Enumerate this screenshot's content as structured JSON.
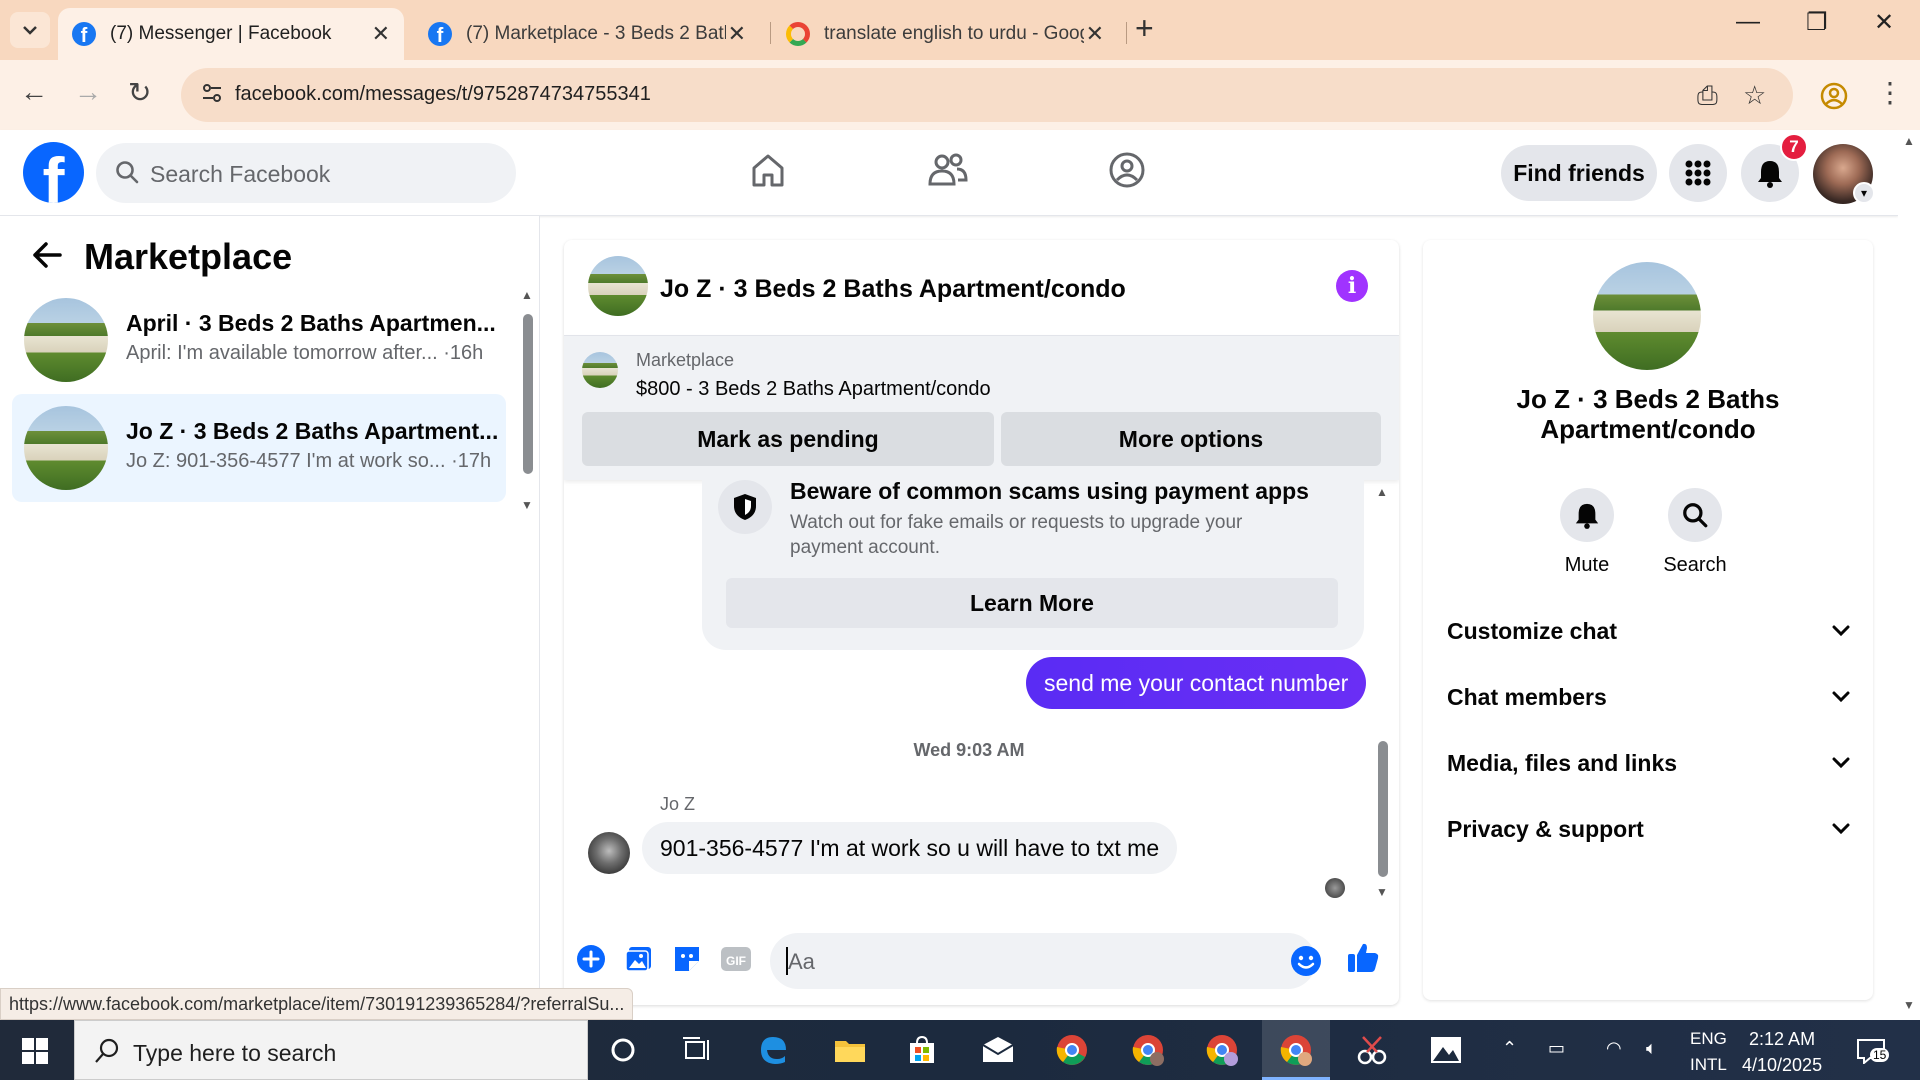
{
  "browser": {
    "tabs": [
      {
        "title": "(7) Messenger | Facebook",
        "active": true,
        "favicon": "facebook-icon"
      },
      {
        "title": "(7) Marketplace - 3 Beds 2 Bath",
        "active": false,
        "favicon": "facebook-icon"
      },
      {
        "title": "translate english to urdu - Goog",
        "active": false,
        "favicon": "google-icon"
      }
    ],
    "url": "facebook.com/messages/t/9752874734755341"
  },
  "fb": {
    "search_placeholder": "Search Facebook",
    "find_friends": "Find friends",
    "notifications_count": "7"
  },
  "sidebar": {
    "title": "Marketplace",
    "conversations": [
      {
        "title": "April · 3 Beds 2 Baths Apartmen...",
        "preview": "April: I'm available tomorrow after... ·16h",
        "selected": false
      },
      {
        "title": "Jo Z · 3 Beds 2 Baths Apartment...",
        "preview": "Jo Z: 901-356-4577 I'm at work so... ·17h",
        "selected": true
      }
    ]
  },
  "chat": {
    "title": "Jo Z · 3 Beds 2 Baths Apartment/condo",
    "listing": {
      "label": "Marketplace",
      "detail": "$800 - 3 Beds 2 Baths Apartment/condo",
      "mark_pending": "Mark as pending",
      "more_options": "More options"
    },
    "scam_notice": {
      "title": "Beware of common scams using payment apps",
      "body": "Watch out for fake emails or requests to upgrade your payment account.",
      "button": "Learn More"
    },
    "outgoing_message": "send me your contact number",
    "timestamp": "Wed 9:03 AM",
    "sender_name": "Jo Z",
    "incoming_message": "901-356-4577 I'm at work so u will have to txt me",
    "composer_placeholder": "Aa"
  },
  "right_panel": {
    "name": "Jo Z · 3 Beds 2 Baths Apartment/condo",
    "actions": [
      {
        "label": "Mute",
        "icon": "bell-icon"
      },
      {
        "label": "Search",
        "icon": "search-icon"
      }
    ],
    "sections": [
      "Customize chat",
      "Chat members",
      "Media, files and links",
      "Privacy & support"
    ]
  },
  "status_link": "https://www.facebook.com/marketplace/item/730191239365284/?referralSu...",
  "taskbar": {
    "search_placeholder": "Type here to search",
    "lang_line1": "ENG",
    "lang_line2": "INTL",
    "time": "2:12 AM",
    "date": "4/10/2025",
    "notification_count": "15"
  },
  "colors": {
    "fb_blue": "#0866ff",
    "messenger_purple": "#5a2cf4",
    "info_purple": "#a033ff",
    "badge_red": "#e41e3f",
    "tabbar": "#f8d8bf"
  }
}
